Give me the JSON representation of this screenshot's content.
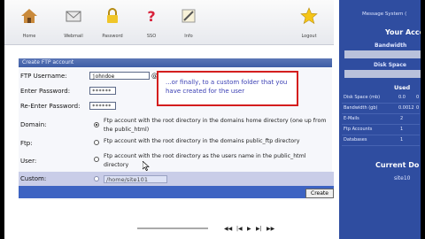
{
  "toolbar": {
    "items": [
      {
        "label": "Home",
        "icon": "home-icon"
      },
      {
        "label": "Webmail",
        "icon": "webmail-icon"
      },
      {
        "label": "Password",
        "icon": "password-lock-icon"
      },
      {
        "label": "SSO",
        "icon": "help-question-icon"
      },
      {
        "label": "Info",
        "icon": "info-tools-icon"
      },
      {
        "label": "Logout",
        "icon": "logout-star-icon"
      }
    ]
  },
  "form": {
    "section_title": "Create FTP account",
    "username_label": "FTP Username:",
    "username_value": "johndoe",
    "username_suffix": "@",
    "password_label": "Enter Password:",
    "password_value": "******",
    "reenter_label": "Re-Enter Password:",
    "reenter_value": "******",
    "domain_label": "Domain:",
    "domain_option": "Ftp account with the root directory in the domains home directory (one up from the public_html)",
    "ftp_label": "Ftp:",
    "ftp_option": "Ftp account with the root directory in the domains public_ftp directory",
    "user_label": "User:",
    "user_option": "Ftp account with the root directory as the users name in the public_html directory",
    "custom_label": "Custom:",
    "custom_path": "/home/site101",
    "create_button": "Create",
    "selected": "domain"
  },
  "callout": {
    "text": "...or finally, to a custom folder that you have created for the user"
  },
  "sidebar": {
    "top_label": "Message System (",
    "your_account": "Your Acco",
    "bandwidth": "Bandwidth",
    "disk_space": "Disk Space",
    "used": "Used",
    "stats": [
      {
        "label": "Disk Space (mb)",
        "value": "0.0",
        "extra": "0"
      },
      {
        "label": "Bandwidth (gb)",
        "value": "0.0012",
        "extra": "0"
      },
      {
        "label": "E-Mails",
        "value": "2",
        "extra": ""
      },
      {
        "label": "Ftp Accounts",
        "value": "1",
        "extra": ""
      },
      {
        "label": "Databases",
        "value": "1",
        "extra": ""
      }
    ],
    "current_domain": "Current Do",
    "site": "site10"
  },
  "colors": {
    "accent": "#3d63c2",
    "callout_border": "#d41e1e",
    "callout_text": "#3a3fb4"
  }
}
